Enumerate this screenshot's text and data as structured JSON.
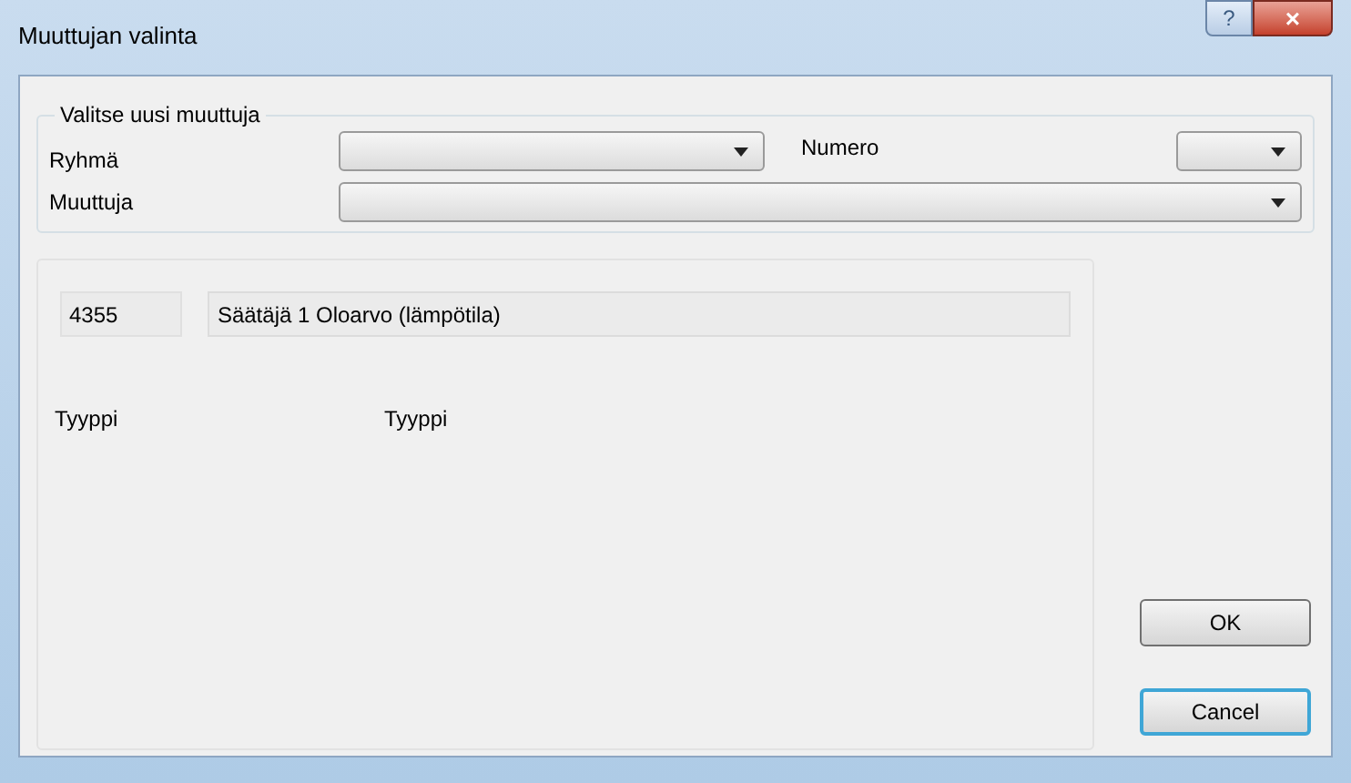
{
  "window": {
    "title": "Muuttujan valinta",
    "help_button": "?",
    "close_button": "×"
  },
  "group": {
    "title": "Valitse uusi muuttuja",
    "group_label": "Ryhmä",
    "number_label": "Numero",
    "variable_label": "Muuttuja"
  },
  "details": {
    "id": "4355",
    "name": "Säätäjä 1 Oloarvo (lämpötila)",
    "type_label": "Tyyppi",
    "type_value": "Tyyppi"
  },
  "buttons": [
    {
      "label": "OK",
      "focused": false
    },
    {
      "label": "Cancel",
      "focused": true
    }
  ]
}
